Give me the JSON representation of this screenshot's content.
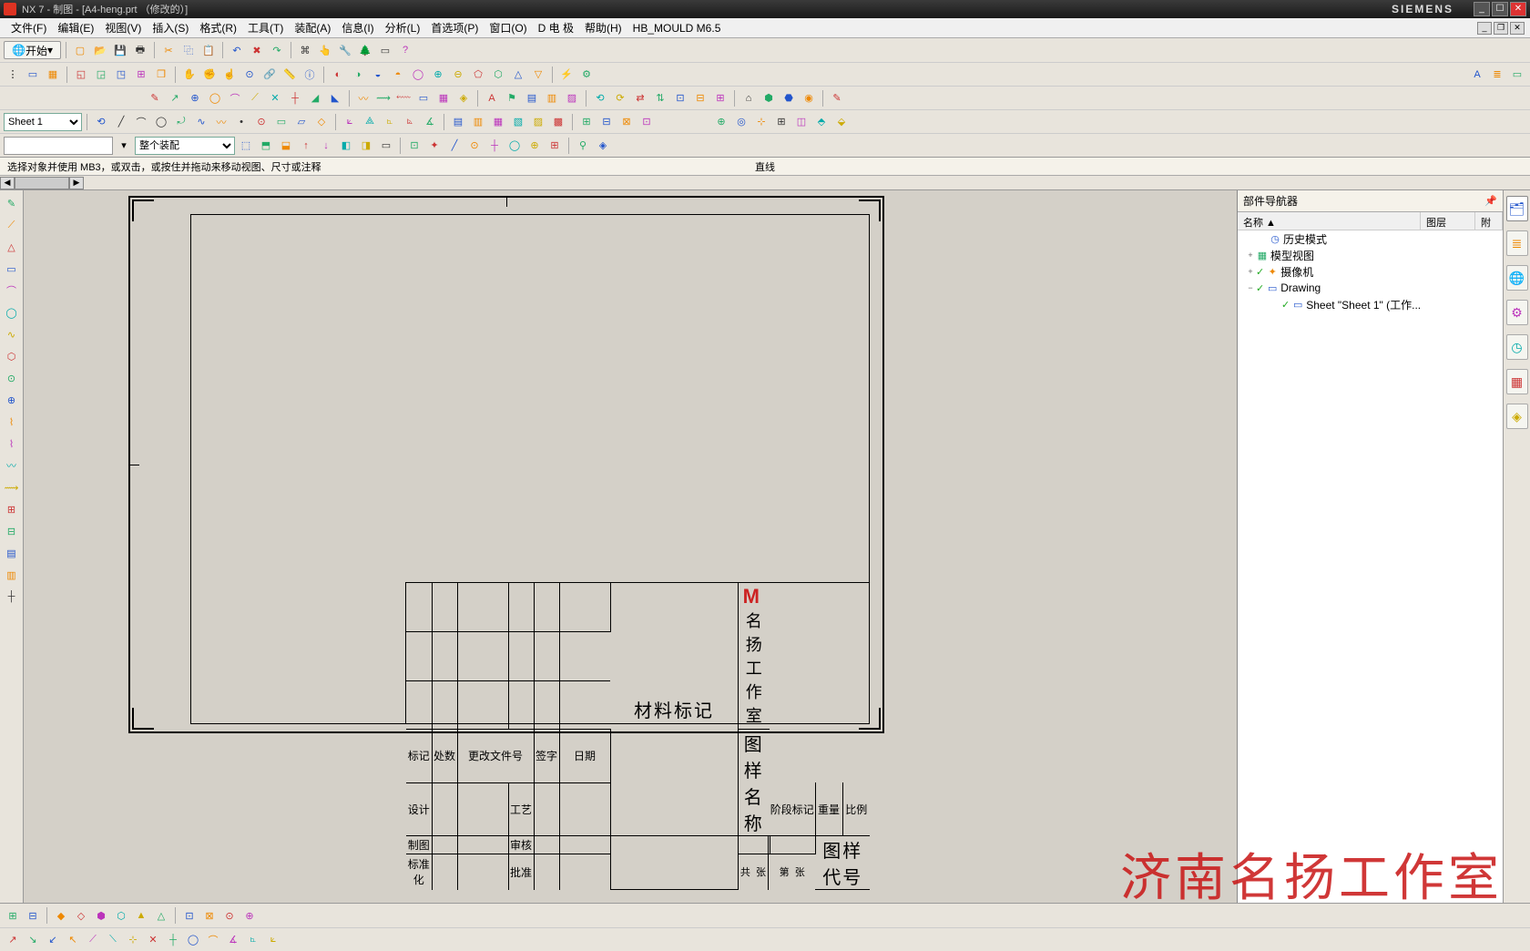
{
  "title": "NX 7 - 制图 - [A4-heng.prt （修改的）]",
  "brand": "SIEMENS",
  "menu": [
    "文件(F)",
    "编辑(E)",
    "视图(V)",
    "插入(S)",
    "格式(R)",
    "工具(T)",
    "装配(A)",
    "信息(I)",
    "分析(L)",
    "首选项(P)",
    "窗口(O)",
    "D 电 极",
    "帮助(H)"
  ],
  "menu_extra": "HB_MOULD M6.5",
  "start_label": "开始",
  "sheet_select": "Sheet 1",
  "assembly_select": "整个装配",
  "prompt": "选择对象并使用 MB3，或双击，或按住并拖动来移动视图、尺寸或注释",
  "prompt_center": "直线",
  "navigator": {
    "title": "部件导航器",
    "cols": {
      "name": "名称",
      "layer": "图层",
      "att": "附"
    },
    "rows": [
      {
        "indent": 1,
        "exp": "",
        "chk": false,
        "ico_class": "ic-b",
        "icon": "◷",
        "label": "历史模式"
      },
      {
        "indent": 0,
        "exp": "+",
        "chk": false,
        "ico_class": "ic-g",
        "icon": "▦",
        "label": "模型视图"
      },
      {
        "indent": 0,
        "exp": "+",
        "chk": true,
        "ico_class": "ic-o",
        "icon": "✦",
        "label": "摄像机"
      },
      {
        "indent": 0,
        "exp": "−",
        "chk": true,
        "ico_class": "ic-b",
        "icon": "▭",
        "label": "Drawing"
      },
      {
        "indent": 2,
        "exp": "",
        "chk": true,
        "ico_class": "ic-b",
        "icon": "▭",
        "label": "Sheet \"Sheet 1\" (工作..."
      }
    ]
  },
  "titleblock": {
    "material": "材料标记",
    "company": "名扬工作室",
    "drawing_name": "图样名称",
    "drawing_code": "图样代号",
    "hdr": {
      "mark": "标记",
      "deal": "处数",
      "change": "更改文件号",
      "sign": "签字",
      "date": "日期"
    },
    "rows": {
      "design": "设计",
      "craft": "工艺",
      "draw": "制图",
      "review": "审核",
      "std": "标准化",
      "approve": "批准",
      "stage": "阶段标记",
      "weight": "重量",
      "scale": "比例",
      "gong": "共",
      "zhang1": "张",
      "di": "第",
      "zhang2": "张"
    }
  },
  "watermark": "济南名扬工作室"
}
